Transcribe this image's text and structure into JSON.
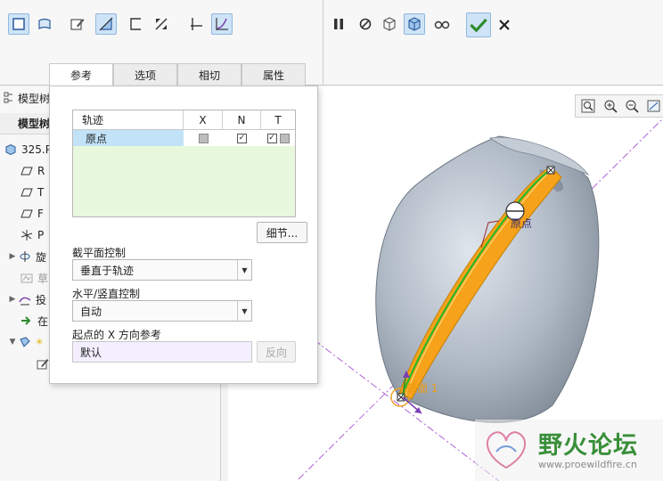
{
  "ribbon": {
    "tabs": [
      "参考",
      "选项",
      "相切",
      "属性"
    ],
    "active_tab": "参考",
    "icons": [
      "solid-icon",
      "surface-icon",
      "sketch-icon",
      "remove-material-icon",
      "thicken-icon",
      "trim-icon",
      "constant-section-icon",
      "variable-section-icon",
      "pause-icon",
      "no-preview-icon",
      "verify-icon",
      "preview-icon",
      "glasses-icon",
      "ok-icon",
      "cancel-icon"
    ]
  },
  "tree": {
    "header1": "模型树",
    "header2": "模型树",
    "items": [
      {
        "label": "325.P",
        "icon": "part-icon",
        "arrow": ""
      },
      {
        "label": "R",
        "icon": "datum-plane-icon",
        "arrow": ""
      },
      {
        "label": "T",
        "icon": "datum-plane-icon",
        "arrow": ""
      },
      {
        "label": "F",
        "icon": "datum-plane-icon",
        "arrow": ""
      },
      {
        "label": "P",
        "icon": "coordinate-system-icon",
        "arrow": ""
      },
      {
        "label": "旋",
        "icon": "revolve-icon",
        "arrow": "▶"
      },
      {
        "label": "草",
        "icon": "sketch-feature-icon",
        "arrow": ""
      },
      {
        "label": "投",
        "icon": "projected-curve-icon",
        "arrow": "▶"
      },
      {
        "label": "在",
        "icon": "insert-here-icon",
        "arrow": ""
      },
      {
        "label": "",
        "icon": "sweep-feature-icon",
        "arrow": "▼"
      },
      {
        "label": "",
        "icon": "sketch-edit-icon",
        "arrow": ""
      }
    ]
  },
  "panel": {
    "table": {
      "headers": [
        "轨迹",
        "X",
        "N",
        "T"
      ],
      "rows": [
        {
          "name": "原点",
          "x": "unchecked-grey",
          "n": "checked",
          "t": "checked-plus-grey"
        }
      ]
    },
    "details_button": "细节...",
    "section_control_label": "截平面控制",
    "section_control_value": "垂直于轨迹",
    "hv_control_label": "水平/竖直控制",
    "hv_control_value": "自动",
    "x_ref_label": "起点的 X 方向参考",
    "x_ref_value": "默认",
    "flip_button": "反向"
  },
  "graphics": {
    "origin_label": "原点",
    "section_label": "截面 1",
    "toolbar_icons": [
      "refit-icon",
      "zoom-in-icon",
      "zoom-out-icon",
      "view-icon"
    ]
  },
  "watermark": {
    "text": "野火论坛",
    "url": "www.proewildfire.cn"
  },
  "colors": {
    "accent": "#2e7d32",
    "selection": "#c2e3f7",
    "collector_bg": "#e8f8dc",
    "model_grey": "#aab3bf",
    "sweep_orange": "#f6a21a",
    "trajectory_green": "#28b828"
  }
}
